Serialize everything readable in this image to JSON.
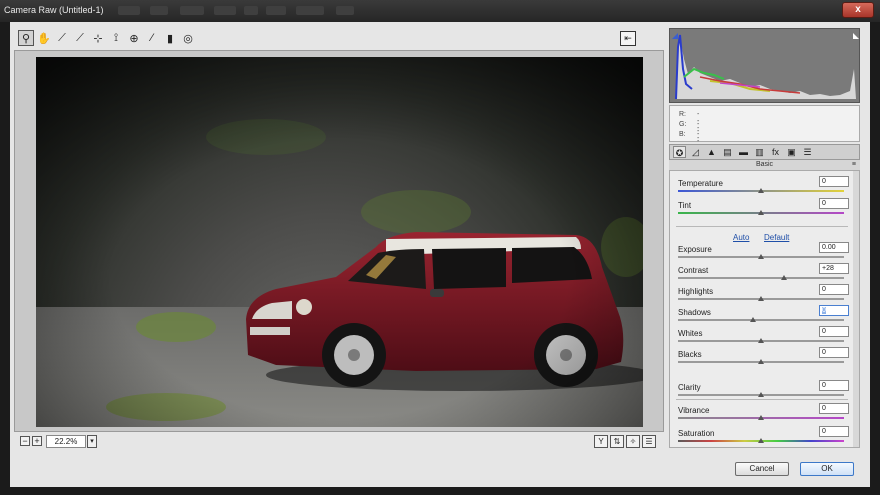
{
  "window": {
    "title": "Camera Raw (Untitled-1)",
    "close_glyph": "x"
  },
  "toolbar": {
    "tools": [
      {
        "name": "zoom-tool-icon",
        "glyph": "⚲",
        "active": true
      },
      {
        "name": "hand-tool-icon",
        "glyph": "✋"
      },
      {
        "name": "white-balance-tool-icon",
        "glyph": "⟋"
      },
      {
        "name": "color-sampler-tool-icon",
        "glyph": "⟋"
      },
      {
        "name": "targeted-adjustment-tool-icon",
        "glyph": "⊹"
      },
      {
        "name": "straighten-tool-icon",
        "glyph": "⟟"
      },
      {
        "name": "red-eye-removal-tool-icon",
        "glyph": "⊕"
      },
      {
        "name": "adjustment-brush-icon",
        "glyph": "⁄"
      },
      {
        "name": "graduated-filter-icon",
        "glyph": "▮"
      },
      {
        "name": "radial-filter-icon",
        "glyph": "◎"
      }
    ],
    "panel_toggle_glyph": "⇤"
  },
  "status": {
    "zoom_minus": "−",
    "zoom_plus": "+",
    "zoom_value": "22.2%",
    "zoom_dropdown": "▾",
    "view_buttons": [
      {
        "name": "before-after-y-icon",
        "glyph": "Y"
      },
      {
        "name": "before-after-swap-icon",
        "glyph": "⇅"
      },
      {
        "name": "before-after-copy-icon",
        "glyph": "✧"
      },
      {
        "name": "preferences-icon",
        "glyph": "☰"
      }
    ]
  },
  "histogram": {
    "r_label": "R:",
    "g_label": "G:",
    "b_label": "B:",
    "r_value": "---",
    "g_value": "---",
    "b_value": "---"
  },
  "tabs": [
    {
      "name": "tab-basic-icon",
      "glyph": "✪"
    },
    {
      "name": "tab-tone-curve-icon",
      "glyph": "◿"
    },
    {
      "name": "tab-detail-icon",
      "glyph": "▲"
    },
    {
      "name": "tab-hsl-icon",
      "glyph": "▤"
    },
    {
      "name": "tab-split-toning-icon",
      "glyph": "▬"
    },
    {
      "name": "tab-lens-corrections-icon",
      "glyph": "▥"
    },
    {
      "name": "tab-effects-icon",
      "glyph": "fx"
    },
    {
      "name": "tab-camera-calibration-icon",
      "glyph": "▣"
    },
    {
      "name": "tab-presets-icon",
      "glyph": "☰"
    }
  ],
  "basic": {
    "heading": "Basic",
    "menu_glyph": "≡",
    "auto_label": "Auto",
    "default_label": "Default",
    "controls": [
      {
        "id": "temperature",
        "label": "Temperature",
        "value": "0",
        "position": 0.5
      },
      {
        "id": "tint",
        "label": "Tint",
        "value": "0",
        "position": 0.5
      },
      {
        "id": "exposure",
        "label": "Exposure",
        "value": "0.00",
        "position": 0.5
      },
      {
        "id": "contrast",
        "label": "Contrast",
        "value": "+28",
        "position": 0.64
      },
      {
        "id": "highlights",
        "label": "Highlights",
        "value": "0",
        "position": 0.5
      },
      {
        "id": "shadows",
        "label": "Shadows",
        "value": "0",
        "position": 0.45,
        "focused": true
      },
      {
        "id": "whites",
        "label": "Whites",
        "value": "0",
        "position": 0.5
      },
      {
        "id": "blacks",
        "label": "Blacks",
        "value": "0",
        "position": 0.5
      },
      {
        "id": "clarity",
        "label": "Clarity",
        "value": "0",
        "position": 0.5
      },
      {
        "id": "vibrance",
        "label": "Vibrance",
        "value": "0",
        "position": 0.5
      },
      {
        "id": "saturation",
        "label": "Saturation",
        "value": "0",
        "position": 0.5
      }
    ]
  },
  "footer": {
    "cancel_label": "Cancel",
    "ok_label": "OK"
  },
  "colors": {
    "temperature_track": [
      "#3c57d6",
      "#e2d23a"
    ],
    "tint_track": [
      "#39b54a",
      "#b548c8"
    ],
    "vibrance_track": [
      "#8a8a8a",
      "#b548c8"
    ],
    "car_body": "#7a1622"
  }
}
